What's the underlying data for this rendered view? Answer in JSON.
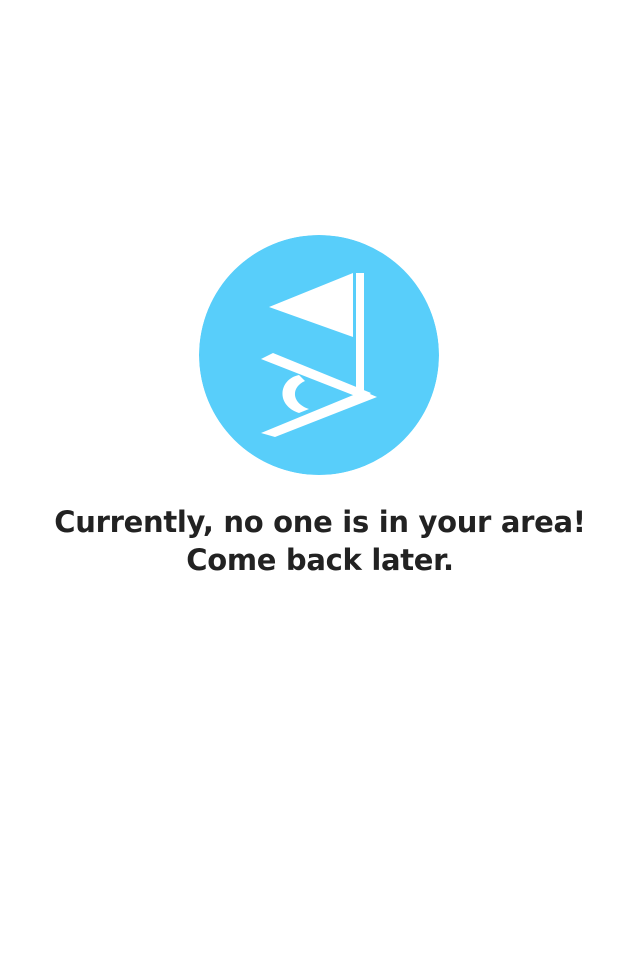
{
  "empty_state": {
    "icon": "flag-logo-icon",
    "accent_color": "#58cefa",
    "message_line_1": "Currently, no one is in your area!",
    "message_line_2": "Come back later."
  }
}
